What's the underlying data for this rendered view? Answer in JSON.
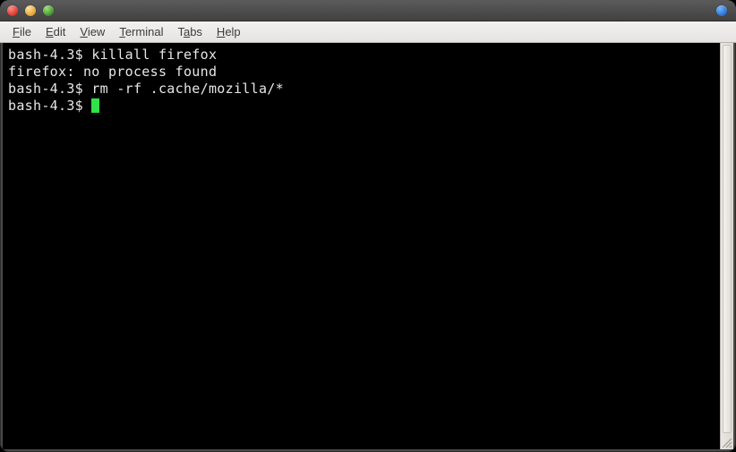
{
  "menubar": {
    "items": [
      {
        "label": "File",
        "accel": "F"
      },
      {
        "label": "Edit",
        "accel": "E"
      },
      {
        "label": "View",
        "accel": "V"
      },
      {
        "label": "Terminal",
        "accel": "T"
      },
      {
        "label": "Tabs",
        "accel": "a"
      },
      {
        "label": "Help",
        "accel": "H"
      }
    ]
  },
  "terminal": {
    "prompt": "bash-4.3$",
    "lines": [
      {
        "prompt": "bash-4.3$",
        "command": "killall firefox"
      },
      {
        "output": "firefox: no process found"
      },
      {
        "prompt": "bash-4.3$",
        "command": "rm -rf .cache/mozilla/*"
      },
      {
        "prompt": "bash-4.3$",
        "cursor": true
      }
    ]
  }
}
